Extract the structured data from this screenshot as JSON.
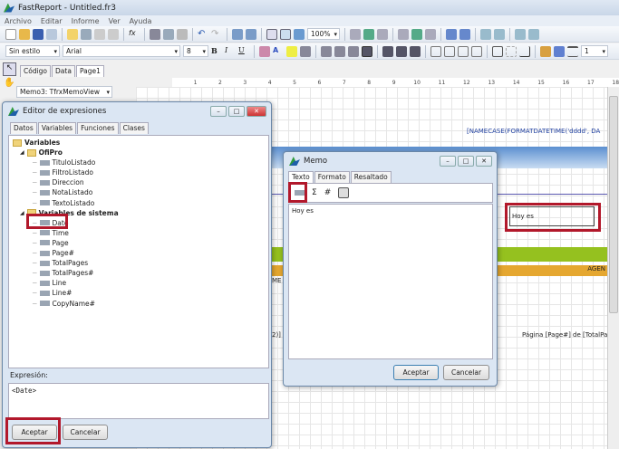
{
  "app": {
    "title": "FastReport - Untitled.fr3"
  },
  "menu": [
    "Archivo",
    "Editar",
    "Informe",
    "Ver",
    "Ayuda"
  ],
  "toolbar": {
    "zoom": "100%",
    "style": "Sin estilo",
    "font": "Arial",
    "size": "8",
    "bold": "B",
    "italic": "I",
    "underline": "U",
    "line_width": "1"
  },
  "tabs": [
    "Código",
    "Data",
    "Page1"
  ],
  "object_selector": "Memo3: TfrxMemoView",
  "ruler": [
    "1",
    "2",
    "3",
    "4",
    "5",
    "6",
    "7",
    "8",
    "9",
    "10",
    "11",
    "12",
    "13",
    "14",
    "15",
    "16",
    "17",
    "18"
  ],
  "report": {
    "header_expr": "[NAMECASE(FORMATDATETIME('dddd', DA",
    "memo_text": "Hoy es",
    "band_label": "AGEN",
    "left_text": "ME",
    "footer_left": "2)]",
    "footer_right": "Página [Page#] de [TotalPag"
  },
  "expr_editor": {
    "title": "Editor de expresiones",
    "tabs": [
      "Datos",
      "Variables",
      "Funciones",
      "Clases"
    ],
    "root": "Variables",
    "group1": "OfiPro",
    "group1_items": [
      "TituloListado",
      "FiltroListado",
      "Direccion",
      "NotaListado",
      "TextoListado"
    ],
    "group2": "Variables de sistema",
    "group2_items": [
      "Date",
      "Time",
      "Page",
      "Page#",
      "TotalPages",
      "TotalPages#",
      "Line",
      "Line#",
      "CopyName#"
    ],
    "expr_label": "Expresión:",
    "expr_value": "<Date>",
    "ok": "Aceptar",
    "cancel": "Cancelar"
  },
  "memo": {
    "title": "Memo",
    "tabs": [
      "Texto",
      "Formato",
      "Resaltado"
    ],
    "text": "Hoy es",
    "ok": "Aceptar",
    "cancel": "Cancelar"
  }
}
